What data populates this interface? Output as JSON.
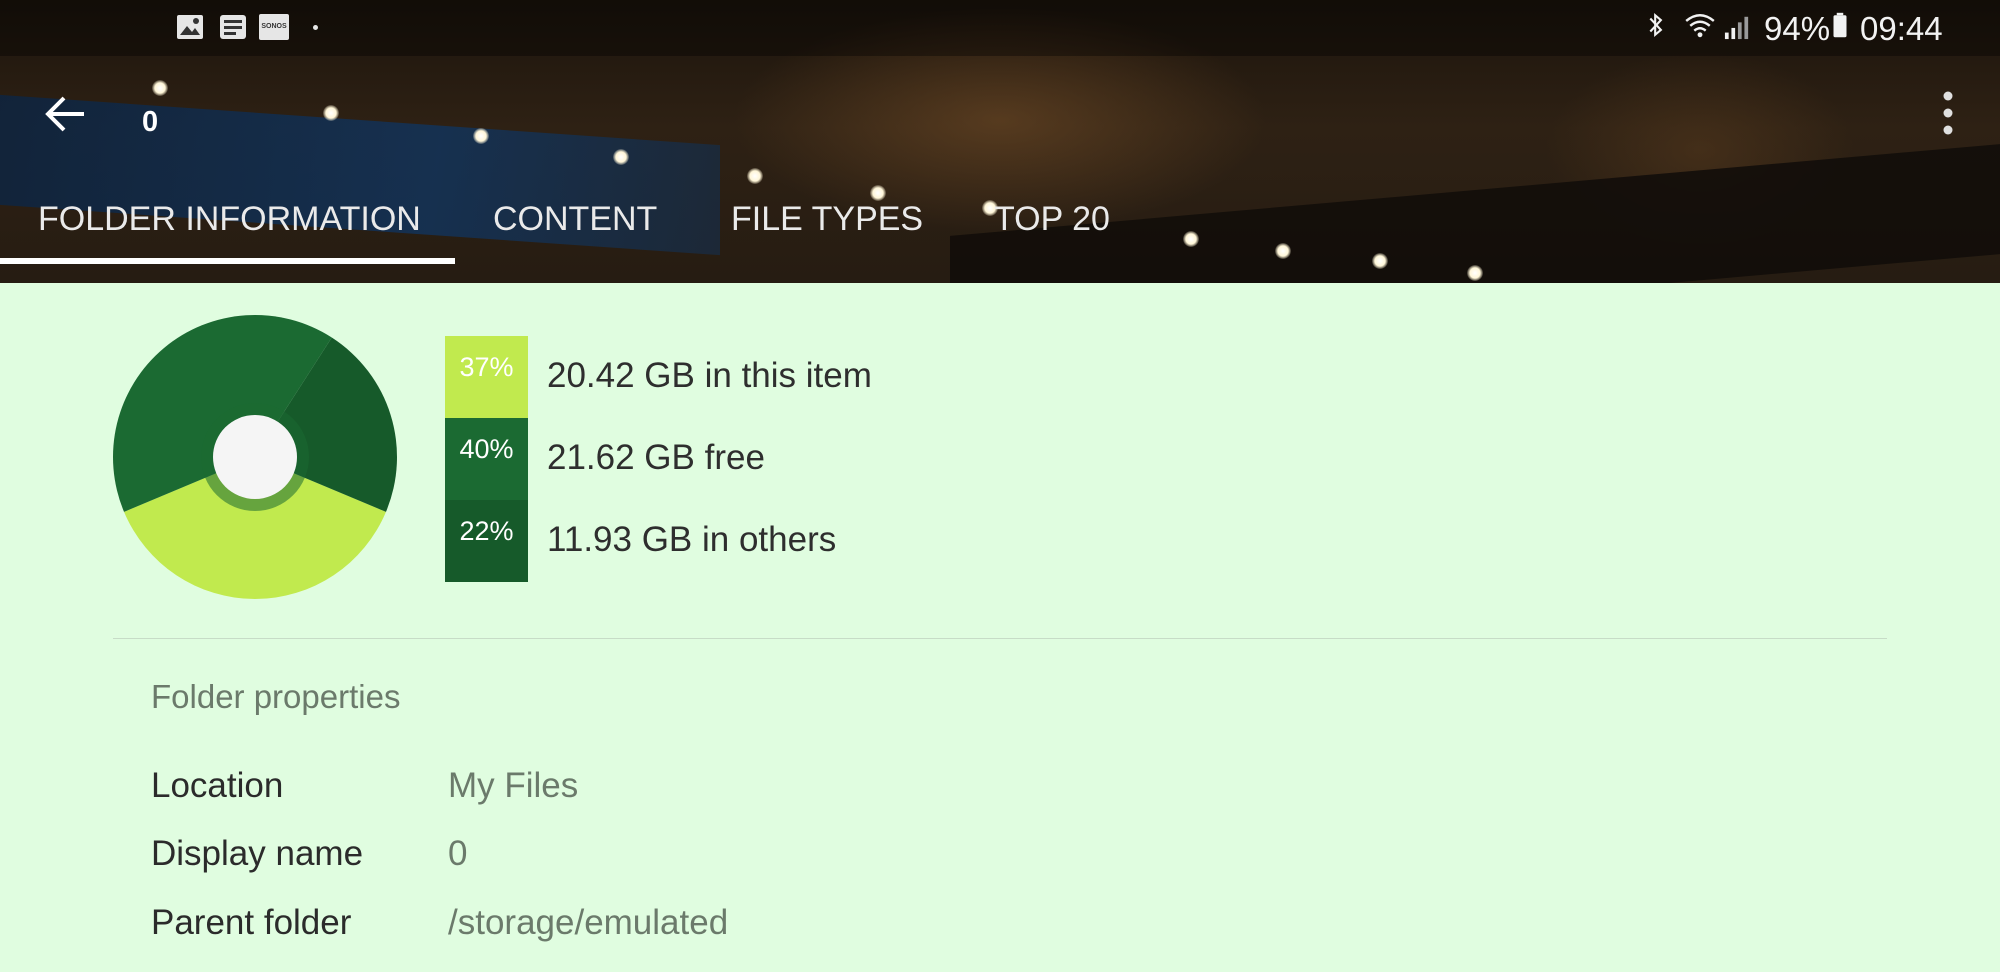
{
  "status_bar": {
    "battery": "94%",
    "time": "09:44",
    "notification_icons": [
      "gallery-icon",
      "news-icon",
      "sonos-icon",
      "dot-icon"
    ],
    "system_icons": [
      "bluetooth-icon",
      "wifi-icon",
      "signal-icon",
      "battery-icon"
    ],
    "sonos_text": "SONOS"
  },
  "toolbar": {
    "title": "0",
    "back_icon": "arrow-left-icon",
    "more_icon": "more-vert-icon"
  },
  "tabs": [
    {
      "label": "FOLDER INFORMATION",
      "active": true
    },
    {
      "label": "CONTENT",
      "active": false
    },
    {
      "label": "FILE TYPES",
      "active": false
    },
    {
      "label": "TOP 20",
      "active": false
    }
  ],
  "colors": {
    "background": "#e0fde0",
    "item": "#c1ea4e",
    "free": "#1b6a32",
    "others": "#165a2a",
    "center": "#f5f5f5"
  },
  "chart_data": {
    "type": "pie",
    "categories": [
      "in this item",
      "free",
      "in others"
    ],
    "values": [
      37,
      40,
      22
    ],
    "unit": "%",
    "sizes_gb": [
      20.42,
      21.62,
      11.93
    ]
  },
  "legend": [
    {
      "percent": "37%",
      "label": "20.42 GB in this item"
    },
    {
      "percent": "40%",
      "label": "21.62 GB free"
    },
    {
      "percent": "22%",
      "label": "11.93 GB in others"
    }
  ],
  "folder_properties": {
    "title": "Folder properties",
    "rows": [
      {
        "key": "Location",
        "value": "My Files"
      },
      {
        "key": "Display name",
        "value": "0"
      },
      {
        "key": "Parent folder",
        "value": "/storage/emulated"
      }
    ]
  }
}
